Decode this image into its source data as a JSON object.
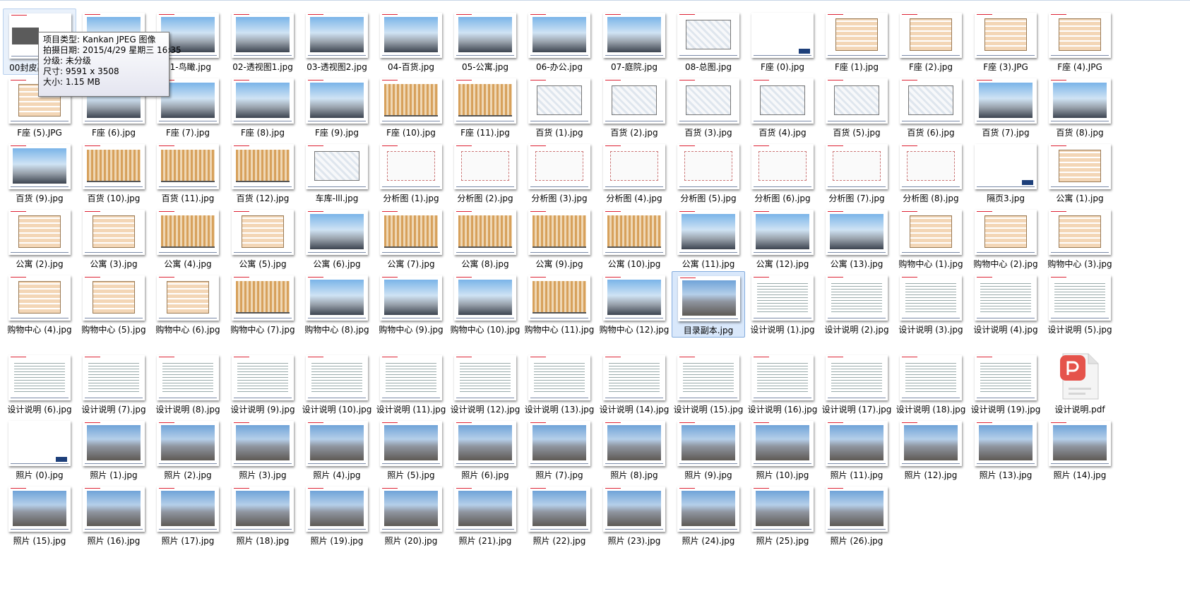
{
  "files": [
    {
      "name": "00封皮副本.jpg",
      "kind": "dark",
      "state": "hover"
    },
    {
      "name": "01-鸟瞰.jpg",
      "kind": "render"
    },
    {
      "name": "01-鸟瞰.jpg",
      "kind": "render"
    },
    {
      "name": "02-透视图1.jpg",
      "kind": "render"
    },
    {
      "name": "03-透视图2.jpg",
      "kind": "render"
    },
    {
      "name": "04-百货.jpg",
      "kind": "render"
    },
    {
      "name": "05-公寓.jpg",
      "kind": "render"
    },
    {
      "name": "06-办公.jpg",
      "kind": "render"
    },
    {
      "name": "07-庭院.jpg",
      "kind": "render"
    },
    {
      "name": "08-总图.jpg",
      "kind": "floor"
    },
    {
      "name": "F座 (0).jpg",
      "kind": "blank"
    },
    {
      "name": "F座 (1).jpg",
      "kind": "plan"
    },
    {
      "name": "F座 (2).jpg",
      "kind": "plan"
    },
    {
      "name": "F座 (3).JPG",
      "kind": "plan"
    },
    {
      "name": "F座 (4).JPG",
      "kind": "plan"
    },
    {
      "name": "F座 (5).JPG",
      "kind": "plan"
    },
    {
      "name": "F座 (6).jpg",
      "kind": "render"
    },
    {
      "name": "F座 (7).jpg",
      "kind": "render"
    },
    {
      "name": "F座 (8).jpg",
      "kind": "render"
    },
    {
      "name": "F座 (9).jpg",
      "kind": "render"
    },
    {
      "name": "F座 (10).jpg",
      "kind": "elev"
    },
    {
      "name": "F座 (11).jpg",
      "kind": "elev"
    },
    {
      "name": "百货 (1).jpg",
      "kind": "floor"
    },
    {
      "name": "百货 (2).jpg",
      "kind": "floor"
    },
    {
      "name": "百货 (3).jpg",
      "kind": "floor"
    },
    {
      "name": "百货 (4).jpg",
      "kind": "floor"
    },
    {
      "name": "百货 (5).jpg",
      "kind": "floor"
    },
    {
      "name": "百货 (6).jpg",
      "kind": "floor"
    },
    {
      "name": "百货 (7).jpg",
      "kind": "render"
    },
    {
      "name": "百货 (8).jpg",
      "kind": "render"
    },
    {
      "name": "百货 (9).jpg",
      "kind": "render"
    },
    {
      "name": "百货 (10).jpg",
      "kind": "elev"
    },
    {
      "name": "百货 (11).jpg",
      "kind": "elev"
    },
    {
      "name": "百货 (12).jpg",
      "kind": "elev"
    },
    {
      "name": "车库-lll.jpg",
      "kind": "floor"
    },
    {
      "name": "分析图 (1).jpg",
      "kind": "diagram"
    },
    {
      "name": "分析图 (2).jpg",
      "kind": "diagram"
    },
    {
      "name": "分析图 (3).jpg",
      "kind": "diagram"
    },
    {
      "name": "分析图 (4).jpg",
      "kind": "diagram"
    },
    {
      "name": "分析图 (5).jpg",
      "kind": "diagram"
    },
    {
      "name": "分析图 (6).jpg",
      "kind": "diagram"
    },
    {
      "name": "分析图 (7).jpg",
      "kind": "diagram"
    },
    {
      "name": "分析图 (8).jpg",
      "kind": "diagram"
    },
    {
      "name": "隔页3.jpg",
      "kind": "blank"
    },
    {
      "name": "公寓 (1).jpg",
      "kind": "plan"
    },
    {
      "name": "公寓 (2).jpg",
      "kind": "plan"
    },
    {
      "name": "公寓 (3).jpg",
      "kind": "plan"
    },
    {
      "name": "公寓 (4).jpg",
      "kind": "elev"
    },
    {
      "name": "公寓 (5).jpg",
      "kind": "plan"
    },
    {
      "name": "公寓 (6).jpg",
      "kind": "render"
    },
    {
      "name": "公寓 (7).jpg",
      "kind": "elev"
    },
    {
      "name": "公寓 (8).jpg",
      "kind": "elev"
    },
    {
      "name": "公寓 (9).jpg",
      "kind": "elev"
    },
    {
      "name": "公寓 (10).jpg",
      "kind": "elev"
    },
    {
      "name": "公寓 (11).jpg",
      "kind": "render"
    },
    {
      "name": "公寓 (12).jpg",
      "kind": "render"
    },
    {
      "name": "公寓 (13).jpg",
      "kind": "render"
    },
    {
      "name": "购物中心 (1).jpg",
      "kind": "plan"
    },
    {
      "name": "购物中心 (2).jpg",
      "kind": "plan"
    },
    {
      "name": "购物中心 (3).jpg",
      "kind": "plan"
    },
    {
      "name": "购物中心 (4).jpg",
      "kind": "plan"
    },
    {
      "name": "购物中心 (5).jpg",
      "kind": "plan"
    },
    {
      "name": "购物中心 (6).jpg",
      "kind": "plan"
    },
    {
      "name": "购物中心 (7).jpg",
      "kind": "elev"
    },
    {
      "name": "购物中心 (8).jpg",
      "kind": "render"
    },
    {
      "name": "购物中心 (9).jpg",
      "kind": "render"
    },
    {
      "name": "购物中心 (10).jpg",
      "kind": "render"
    },
    {
      "name": "购物中心 (11).jpg",
      "kind": "elev"
    },
    {
      "name": "购物中心 (12).jpg",
      "kind": "render"
    },
    {
      "name": "目录副本.jpg",
      "kind": "photo",
      "state": "selected"
    },
    {
      "name": "设计说明 (1).jpg",
      "kind": "text"
    },
    {
      "name": "设计说明 (2).jpg",
      "kind": "text"
    },
    {
      "name": "设计说明 (3).jpg",
      "kind": "text"
    },
    {
      "name": "设计说明 (4).jpg",
      "kind": "text"
    },
    {
      "name": "设计说明 (5).jpg",
      "kind": "text"
    },
    {
      "name": "设计说明 (6).jpg",
      "kind": "text"
    },
    {
      "name": "设计说明 (7).jpg",
      "kind": "text"
    },
    {
      "name": "设计说明 (8).jpg",
      "kind": "text"
    },
    {
      "name": "设计说明 (9).jpg",
      "kind": "text"
    },
    {
      "name": "设计说明 (10).jpg",
      "kind": "text"
    },
    {
      "name": "设计说明 (11).jpg",
      "kind": "text"
    },
    {
      "name": "设计说明 (12).jpg",
      "kind": "text"
    },
    {
      "name": "设计说明 (13).jpg",
      "kind": "text"
    },
    {
      "name": "设计说明 (14).jpg",
      "kind": "text"
    },
    {
      "name": "设计说明 (15).jpg",
      "kind": "text"
    },
    {
      "name": "设计说明 (16).jpg",
      "kind": "text"
    },
    {
      "name": "设计说明 (17).jpg",
      "kind": "text"
    },
    {
      "name": "设计说明 (18).jpg",
      "kind": "text"
    },
    {
      "name": "设计说明 (19).jpg",
      "kind": "text"
    },
    {
      "name": "设计说明.pdf",
      "kind": "pdf"
    },
    {
      "name": "照片 (0).jpg",
      "kind": "blank"
    },
    {
      "name": "照片 (1).jpg",
      "kind": "photo"
    },
    {
      "name": "照片 (2).jpg",
      "kind": "photo"
    },
    {
      "name": "照片 (3).jpg",
      "kind": "photo"
    },
    {
      "name": "照片 (4).jpg",
      "kind": "photo"
    },
    {
      "name": "照片 (5).jpg",
      "kind": "photo"
    },
    {
      "name": "照片 (6).jpg",
      "kind": "photo"
    },
    {
      "name": "照片 (7).jpg",
      "kind": "photo"
    },
    {
      "name": "照片 (8).jpg",
      "kind": "photo"
    },
    {
      "name": "照片 (9).jpg",
      "kind": "photo"
    },
    {
      "name": "照片 (10).jpg",
      "kind": "photo"
    },
    {
      "name": "照片 (11).jpg",
      "kind": "photo"
    },
    {
      "name": "照片 (12).jpg",
      "kind": "photo"
    },
    {
      "name": "照片 (13).jpg",
      "kind": "photo"
    },
    {
      "name": "照片 (14).jpg",
      "kind": "photo"
    },
    {
      "name": "照片 (15).jpg",
      "kind": "photo"
    },
    {
      "name": "照片 (16).jpg",
      "kind": "photo"
    },
    {
      "name": "照片 (17).jpg",
      "kind": "photo"
    },
    {
      "name": "照片 (18).jpg",
      "kind": "photo"
    },
    {
      "name": "照片 (19).jpg",
      "kind": "photo"
    },
    {
      "name": "照片 (20).jpg",
      "kind": "photo"
    },
    {
      "name": "照片 (21).jpg",
      "kind": "photo"
    },
    {
      "name": "照片 (22).jpg",
      "kind": "photo"
    },
    {
      "name": "照片 (23).jpg",
      "kind": "photo"
    },
    {
      "name": "照片 (24).jpg",
      "kind": "photo"
    },
    {
      "name": "照片 (25).jpg",
      "kind": "photo"
    },
    {
      "name": "照片 (26).jpg",
      "kind": "photo"
    }
  ],
  "tooltip": {
    "type": "项目类型: Kankan JPEG 图像",
    "date": "拍摄日期: 2015/4/29 星期三 16:35",
    "rating": "分级: 未分级",
    "dimensions": "尺寸: 9591 x 3508",
    "size": "大小: 1.15 MB"
  },
  "colors": {
    "selection": "#d9e8fb",
    "selection_border": "#84acdd",
    "pdf_red": "#e5534b"
  }
}
